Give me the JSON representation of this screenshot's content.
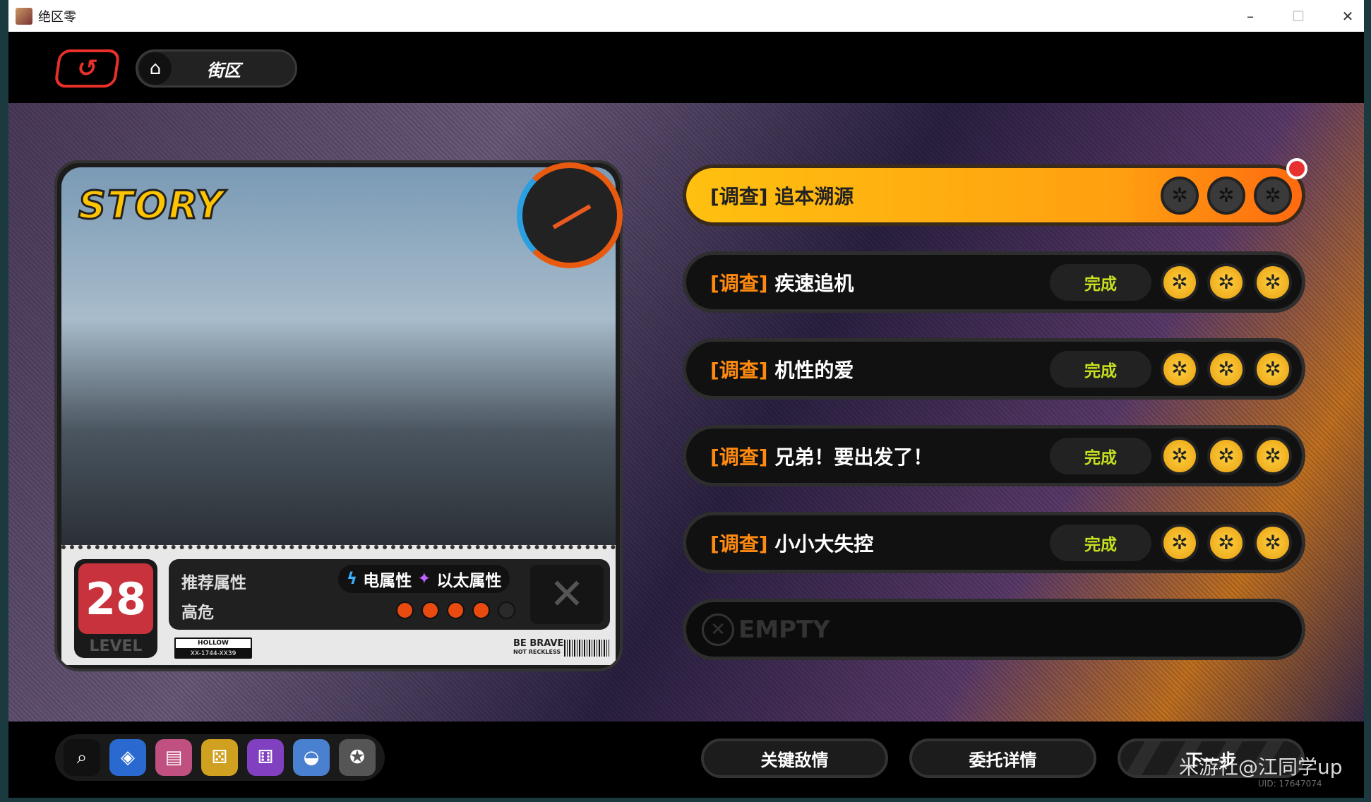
{
  "window": {
    "title": "绝区零",
    "minimize": "–",
    "maximize": "☐",
    "close": "✕"
  },
  "nav": {
    "back_icon": "↺",
    "home_icon": "⌂",
    "location": "街区"
  },
  "card": {
    "story_label": "STORY",
    "level": "28",
    "level_label": "LEVEL",
    "recommend_label": "推荐属性",
    "attr1": "电属性",
    "attr2": "以太属性",
    "danger_label": "高危",
    "danger_level": 4,
    "danger_max": 5,
    "plate_top": "HOLLOW",
    "plate_bottom": "XX-1744-XX39",
    "brave": "BE BRAVE",
    "reckless": "NOT RECKLESS"
  },
  "quests": [
    {
      "tag": "[调查]",
      "title": "追本溯源",
      "status": "",
      "active": true
    },
    {
      "tag": "[调查]",
      "title": "疾速追机",
      "status": "完成"
    },
    {
      "tag": "[调查]",
      "title": "机性的爱",
      "status": "完成"
    },
    {
      "tag": "[调查]",
      "title": "兄弟！要出发了！",
      "status": "完成"
    },
    {
      "tag": "[调查]",
      "title": "小小大失控",
      "status": "完成"
    }
  ],
  "empty_slot": "EMPTY",
  "bottom": {
    "btn1": "关键敌情",
    "btn2": "委托详情",
    "btn3": "下一步"
  },
  "watermark": {
    "text": "米游社@江同学up",
    "uid": "UID: 17647074"
  },
  "colors": {
    "accent": "#ffa010",
    "done": "#c8e020",
    "level": "#c8323c"
  }
}
